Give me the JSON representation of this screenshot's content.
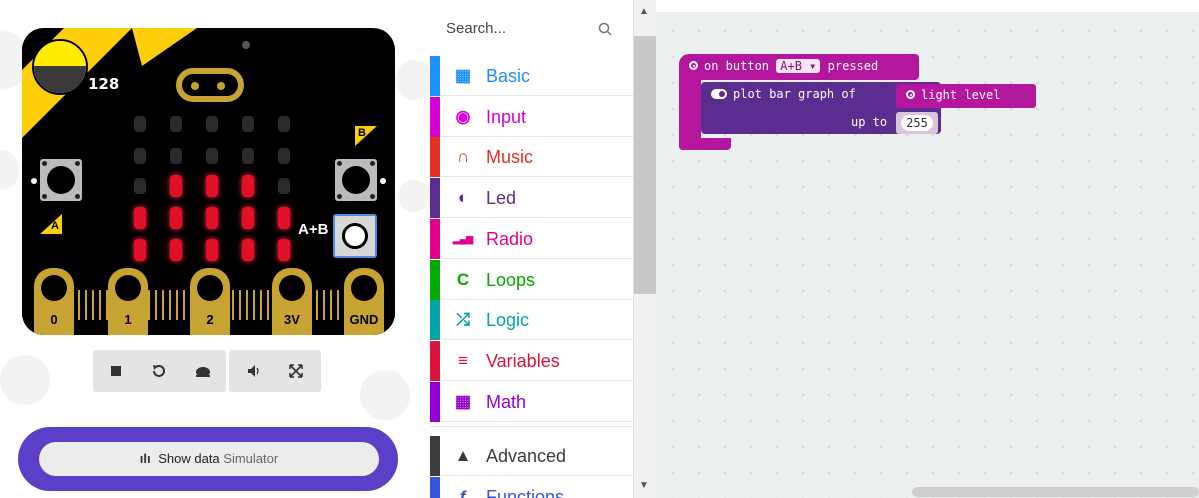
{
  "simulator": {
    "light_level_value": "128",
    "button_a_label": "A",
    "button_b_label": "B",
    "button_ab_label": "A+B",
    "pins": [
      "0",
      "1",
      "2",
      "3V",
      "GND"
    ],
    "led_matrix": [
      [
        0,
        0,
        0,
        0,
        0
      ],
      [
        0,
        0,
        0,
        0,
        0
      ],
      [
        0,
        1,
        1,
        1,
        0
      ],
      [
        1,
        1,
        1,
        1,
        1
      ],
      [
        1,
        1,
        1,
        1,
        1
      ]
    ],
    "toolbar_icons": [
      "stop-icon",
      "restart-icon",
      "slow-mo-icon",
      "mute-icon",
      "fullscreen-icon"
    ],
    "show_data_label": "Show data",
    "show_data_sublabel": "Simulator"
  },
  "toolbox": {
    "search_placeholder": "Search...",
    "categories": [
      {
        "label": "Basic",
        "color": "#1e90ff",
        "icon": "grid-icon"
      },
      {
        "label": "Input",
        "color": "#d400d4",
        "icon": "radio-button-icon"
      },
      {
        "label": "Music",
        "color": "#e63022",
        "icon": "headphones-icon"
      },
      {
        "label": "Led",
        "color": "#5c2d91",
        "icon": "toggle-icon"
      },
      {
        "label": "Radio",
        "color": "#e3008c",
        "icon": "signal-icon"
      },
      {
        "label": "Loops",
        "color": "#00aa00",
        "icon": "refresh-icon"
      },
      {
        "label": "Logic",
        "color": "#00a4a6",
        "icon": "shuffle-icon"
      },
      {
        "label": "Variables",
        "color": "#dc143c",
        "icon": "list-icon"
      },
      {
        "label": "Math",
        "color": "#9400d3",
        "icon": "calculator-icon"
      },
      {
        "label": "Advanced",
        "color": "#3c3c3c",
        "icon": "chevron-up-icon"
      },
      {
        "label": "Functions",
        "color": "#3455db",
        "icon": "function-icon"
      }
    ]
  },
  "workspace": {
    "event_block": {
      "prefix": "on button",
      "dropdown": "A+B",
      "suffix": "pressed"
    },
    "plot_block": {
      "label": "plot bar graph of",
      "up_to_label": "up to",
      "up_to_value": "255"
    },
    "reporter_block": {
      "label": "light level"
    }
  }
}
